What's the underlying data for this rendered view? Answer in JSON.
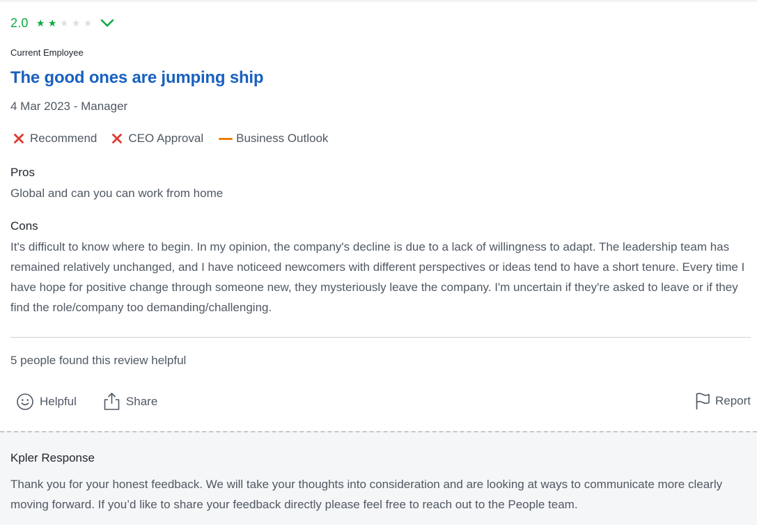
{
  "review": {
    "rating": "2.0",
    "stars_filled": 2,
    "stars_total": 5,
    "employee_status": "Current Employee",
    "title": "The good ones are jumping ship",
    "meta": "4 Mar 2023 - Manager",
    "ratings": {
      "recommend": "Recommend",
      "ceo_approval": "CEO Approval",
      "business_outlook": "Business Outlook"
    },
    "pros_label": "Pros",
    "pros_text": "Global and can you can work from home",
    "cons_label": "Cons",
    "cons_text": "It's difficult to know where to begin. In my opinion, the company's decline is due to a lack of willingness to adapt. The leadership team has remained relatively unchanged, and I have noticeed newcomers with different perspectives or ideas tend to have a short tenure. Every time I have hope for positive change through someone new, they mysteriously leave the company. I'm uncertain if they're asked to leave or if they find the role/company too demanding/challenging.",
    "helpful_count": "5 people found this review helpful"
  },
  "actions": {
    "helpful": "Helpful",
    "share": "Share",
    "report": "Report"
  },
  "response": {
    "title": "Kpler Response",
    "text": "Thank you for your honest feedback. We will take your thoughts into consideration and are looking at ways to communicate more clearly moving forward. If you’d like to share your feedback directly please feel free to reach out to the People team."
  },
  "icons": {
    "star": "star-icon",
    "expand": "chevron-down-icon",
    "negative": "x-mark-icon",
    "neutral": "dash-icon",
    "helpful": "smiley-icon",
    "share": "share-icon",
    "report": "flag-icon"
  },
  "colors": {
    "rating_green": "#0caa41",
    "title_blue": "#1861bf",
    "negative_red": "#dd3b2e",
    "neutral_orange": "#ef7d04",
    "response_bg": "#f5f6f7"
  }
}
